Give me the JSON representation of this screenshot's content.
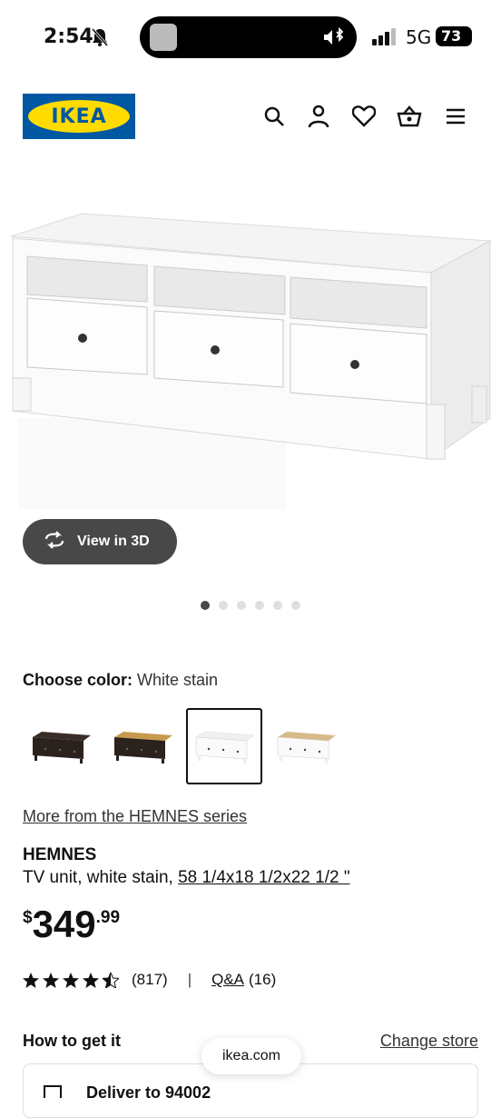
{
  "status_bar": {
    "time": "2:54",
    "network": "5G",
    "battery": "73"
  },
  "header": {
    "logo_text": "IKEA",
    "brand_colors": {
      "blue": "#0058a3",
      "yellow": "#ffdb00"
    },
    "icons": [
      "search-icon",
      "account-icon",
      "wishlist-icon",
      "cart-icon",
      "menu-icon"
    ]
  },
  "gallery": {
    "view_3d_label": "View in 3D",
    "total_images": 6,
    "active_index": 0
  },
  "color": {
    "label": "Choose color:",
    "selected": "White stain",
    "options": [
      "black-brown",
      "black-brown-light-brown",
      "white-stain",
      "white-stain-light-brown"
    ],
    "selected_index": 2
  },
  "product": {
    "series_link": "More from the HEMNES series",
    "name": "HEMNES",
    "description": "TV unit, white stain,",
    "dimensions": "58 1/4x18 1/2x22 1/2 \"",
    "price_currency": "$",
    "price_integer": "349",
    "price_decimal": ".99",
    "rating": 4.5,
    "reviews": "(817)",
    "separator": "|",
    "qa_label": "Q&A",
    "qa_count": "(16)"
  },
  "fulfillment": {
    "title": "How to get it",
    "change_store": "Change store",
    "delivery_label": "Deliver to 94002"
  },
  "browser": {
    "url": "ikea.com"
  }
}
